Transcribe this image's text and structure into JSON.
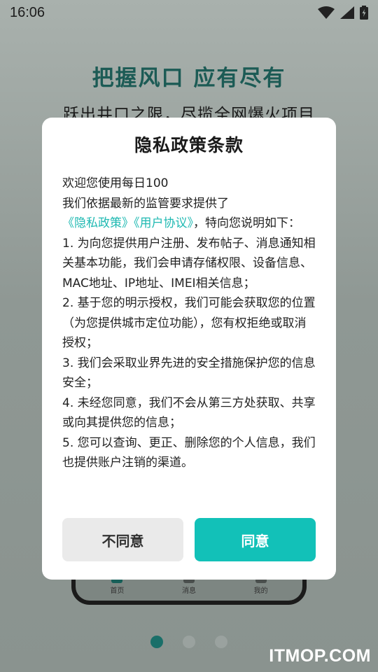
{
  "status_bar": {
    "time": "16:06",
    "icons": [
      "wifi-icon",
      "cellular-signal-icon",
      "battery-icon"
    ]
  },
  "background": {
    "headline": "把握风口  应有尽有",
    "subline": "跃出井口之限，尽揽全网爆火项目",
    "phone_nav": [
      {
        "label": "首页",
        "icon": "home-icon",
        "active": true
      },
      {
        "label": "消息",
        "icon": "message-icon",
        "active": false
      },
      {
        "label": "我的",
        "icon": "profile-icon",
        "active": false
      }
    ]
  },
  "dialog": {
    "title": "隐私政策条款",
    "intro_line1": "欢迎您使用每日100",
    "intro_line2": "我们依据最新的监管要求提供了",
    "link_privacy": "《隐私政策》",
    "link_agreement": "《用户协议》",
    "intro_tail": "，特向您说明如下：",
    "item1": "1. 为向您提供用户注册、发布帖子、消息通知相关基本功能，我们会申请存储权限、设备信息、MAC地址、IP地址、IMEI相关信息；",
    "item2": "2. 基于您的明示授权，我们可能会获取您的位置（为您提供城市定位功能），您有权拒绝或取消授权；",
    "item3": "3. 我们会采取业界先进的安全措施保护您的信息安全；",
    "item4": "4. 未经您同意，我们不会从第三方处获取、共享或向其提供您的信息；",
    "item5": "5. 您可以查询、更正、删除您的个人信息，我们也提供账户注销的渠道。",
    "decline_label": "不同意",
    "accept_label": "同意"
  },
  "pager": {
    "count": 3,
    "active_index": 0
  },
  "watermark": "ITMOP.COM",
  "colors": {
    "accent": "#12c1b8",
    "link": "#1fb9b2",
    "headline": "#1c5b55"
  }
}
